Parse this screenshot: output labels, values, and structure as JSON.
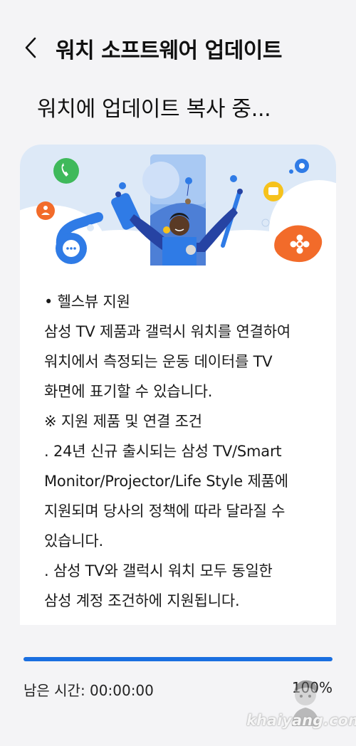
{
  "header": {
    "back_icon": "chevron-left-icon",
    "title": "워치 소프트웨어 업데이트"
  },
  "status": {
    "title": "워치에 업데이트 복사 중..."
  },
  "hero": {
    "description_icons": [
      "phone-icon",
      "person-icon",
      "chat-icon",
      "settings-icon",
      "gallery-icon",
      "flower-icon",
      "pencil-icon",
      "watch-icon"
    ],
    "colors": {
      "green": "#3fb95b",
      "blue": "#2f7be6",
      "yellow": "#f6c21c",
      "orange": "#f26b2a",
      "navy": "#2643a3"
    }
  },
  "release_notes": {
    "lines": [
      "• 헬스뷰 지원",
      "삼성 TV 제품과 갤럭시 워치를 연결하여",
      "워치에서 측정되는 운동 데이터를 TV",
      "화면에 표기할 수 있습니다.",
      "※ 지원 제품 및 연결 조건",
      " . 24년 신규 출시되는 삼성 TV/Smart",
      "Monitor/Projector/Life Style 제품에",
      "지원되며 당사의 정책에 따라 달라질 수",
      "있습니다.",
      " . 삼성 TV와 갤럭시 워치 모두 동일한",
      "삼성 계정 조건하에 지원됩니다."
    ]
  },
  "progress": {
    "fraction": 1.0,
    "remaining_label": "남은 시간: 00:00:00",
    "percent_label": "100%",
    "color": "#1a6fe0"
  },
  "watermark": {
    "text": "khaiyang.com"
  }
}
